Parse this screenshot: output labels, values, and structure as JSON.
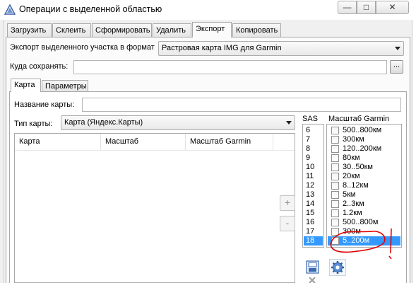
{
  "window": {
    "title": "Операции с выделенной областью",
    "minimize_glyph": "—",
    "maximize_glyph": "□",
    "close_glyph": "✕"
  },
  "tabs": [
    {
      "label": "Загрузить",
      "active": false
    },
    {
      "label": "Склеить",
      "active": false
    },
    {
      "label": "Сформировать",
      "active": false
    },
    {
      "label": "Удалить",
      "active": false
    },
    {
      "label": "Экспорт",
      "active": true
    },
    {
      "label": "Копировать",
      "active": false
    }
  ],
  "export": {
    "format_label": "Экспорт выделенного участка в формат",
    "format_value": "Растровая карта IMG для Garmin",
    "save_label": "Куда сохранять:",
    "save_value": "",
    "browse_label": "..."
  },
  "inner_tabs": [
    {
      "label": "Карта",
      "active": true
    },
    {
      "label": "Параметры",
      "active": false
    }
  ],
  "map": {
    "name_label": "Название карты:",
    "name_value": "",
    "type_label": "Тип карты:",
    "type_value": "Карта (Яндекс.Карты)"
  },
  "list": {
    "columns": [
      "Карта",
      "Масштаб",
      "Масштаб Garmin"
    ]
  },
  "buttons": {
    "add": "+",
    "remove": "-"
  },
  "sas": {
    "header": "SAS",
    "items": [
      "6",
      "7",
      "8",
      "9",
      "10",
      "11",
      "12",
      "13",
      "14",
      "15",
      "16",
      "17",
      "18"
    ],
    "selected": "18"
  },
  "garmin": {
    "header": "Масштаб Garmin",
    "items": [
      "500..800км",
      "300км",
      "120..200км",
      "80км",
      "30..50км",
      "20км",
      "8..12км",
      "5км",
      "2..3км",
      "1.2км",
      "500..800м",
      "300м",
      "5..200м"
    ],
    "selected": "5..200м",
    "checked": []
  },
  "colors": {
    "selection": "#3399ff",
    "annotation": "#e00000"
  },
  "icons": [
    "app-icon",
    "minimize-icon",
    "maximize-icon",
    "close-icon",
    "dropdown-arrow-icon",
    "save-settings-icon",
    "gear-icon",
    "close-small-icon"
  ]
}
